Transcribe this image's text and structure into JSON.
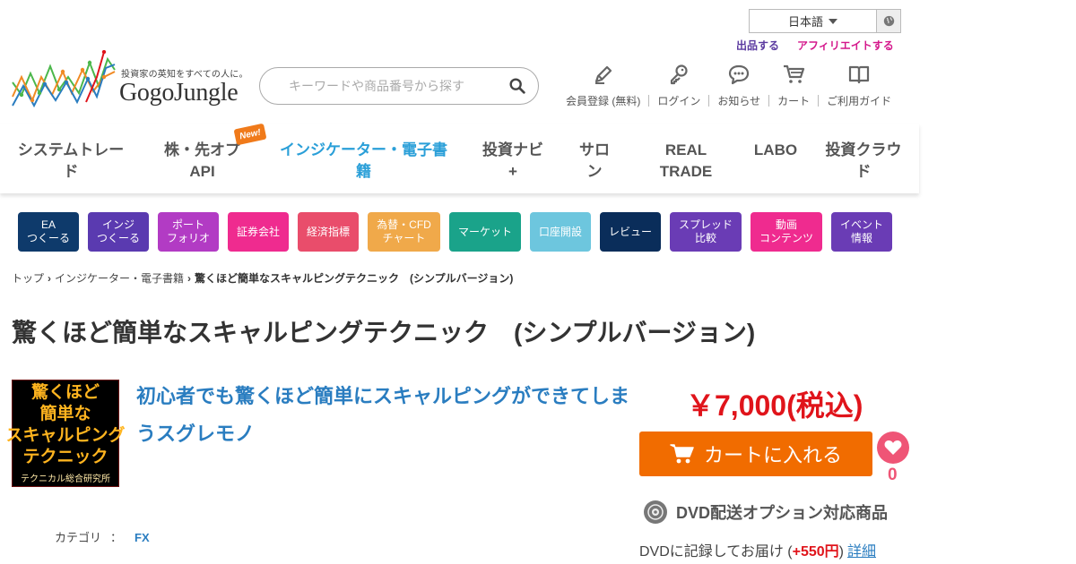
{
  "header": {
    "language": "日本語",
    "links": {
      "sell": "出品する",
      "affiliate": "アフィリエイトする"
    },
    "logo": {
      "tagline": "投資家の英知をすべての人に。",
      "name": "GogoJungle"
    },
    "search": {
      "placeholder": "キーワードや商品番号から探す"
    },
    "user_nav": [
      {
        "label": "会員登録 (無料)",
        "icon": "pencil-icon"
      },
      {
        "label": "ログイン",
        "icon": "key-icon"
      },
      {
        "label": "お知らせ",
        "icon": "chat-bubble-icon"
      },
      {
        "label": "カート",
        "icon": "cart-icon"
      },
      {
        "label": "ご利用ガイド",
        "icon": "book-icon"
      }
    ]
  },
  "main_nav": {
    "new_badge": "New!",
    "items": [
      {
        "line1": "システムトレー",
        "line2": "ド"
      },
      {
        "line1": "株・先オプ",
        "line2": "API"
      },
      {
        "line1": "インジケーター・電子書",
        "line2": "籍",
        "active": true
      },
      {
        "line1": "投資ナビ",
        "line2": "+"
      },
      {
        "line1": "サロ",
        "line2": "ン"
      },
      {
        "line1": "REAL",
        "line2": "TRADE"
      },
      {
        "line1": "LABO",
        "line2": ""
      },
      {
        "line1": "投資クラウ",
        "line2": "ド"
      }
    ]
  },
  "categories": [
    {
      "line1": "EA",
      "line2": "つくーる",
      "color": "#0e3a6b"
    },
    {
      "line1": "インジ",
      "line2": "つくーる",
      "color": "#5a3ab0"
    },
    {
      "line1": "ポート",
      "line2": "フォリオ",
      "color": "#b23bc4"
    },
    {
      "line1": "証券会社",
      "line2": "",
      "color": "#ef2b8f"
    },
    {
      "line1": "経済指標",
      "line2": "",
      "color": "#e94d6b"
    },
    {
      "line1": "為替・CFD",
      "line2": "チャート",
      "color": "#f0a94a"
    },
    {
      "line1": "マーケット",
      "line2": "",
      "color": "#1aa38a"
    },
    {
      "line1": "口座開設",
      "line2": "",
      "color": "#6dc6de"
    },
    {
      "line1": "レビュー",
      "line2": "",
      "color": "#0a2d5a"
    },
    {
      "line1": "スプレッド",
      "line2": "比較",
      "color": "#6a3cb5"
    },
    {
      "line1": "動画",
      "line2": "コンテンツ",
      "color": "#ef2b8f"
    },
    {
      "line1": "イベント",
      "line2": "情報",
      "color": "#6a3cb5"
    }
  ],
  "breadcrumb": {
    "home": "トップ",
    "category": "インジケーター・電子書籍",
    "current": "驚くほど簡単なスキャルピングテクニック　(シンプルバージョン)"
  },
  "product": {
    "title": "驚くほど簡単なスキャルピングテクニック　(シンプルバージョン)",
    "subtitle": "初心者でも驚くほど簡単にスキャルピングができてしまうスグレモノ",
    "thumbnail": {
      "line1": "驚くほど",
      "line2": "簡単な",
      "line3": "スキャルピング",
      "line4": "テクニック",
      "line5": "テクニカル総合研究所"
    },
    "category_label": "カテゴリ",
    "category_colon": "：",
    "category_value": "FX",
    "price": "￥7,000(税込)",
    "cart_button": "カートに入れる",
    "favorite_count": "0",
    "dvd_option": "DVD配送オプション対応商品",
    "dvd_note_prefix": "DVDに記録してお届け (",
    "dvd_note_price": "+550円",
    "dvd_note_suffix": ")",
    "dvd_detail_link": "詳細"
  }
}
